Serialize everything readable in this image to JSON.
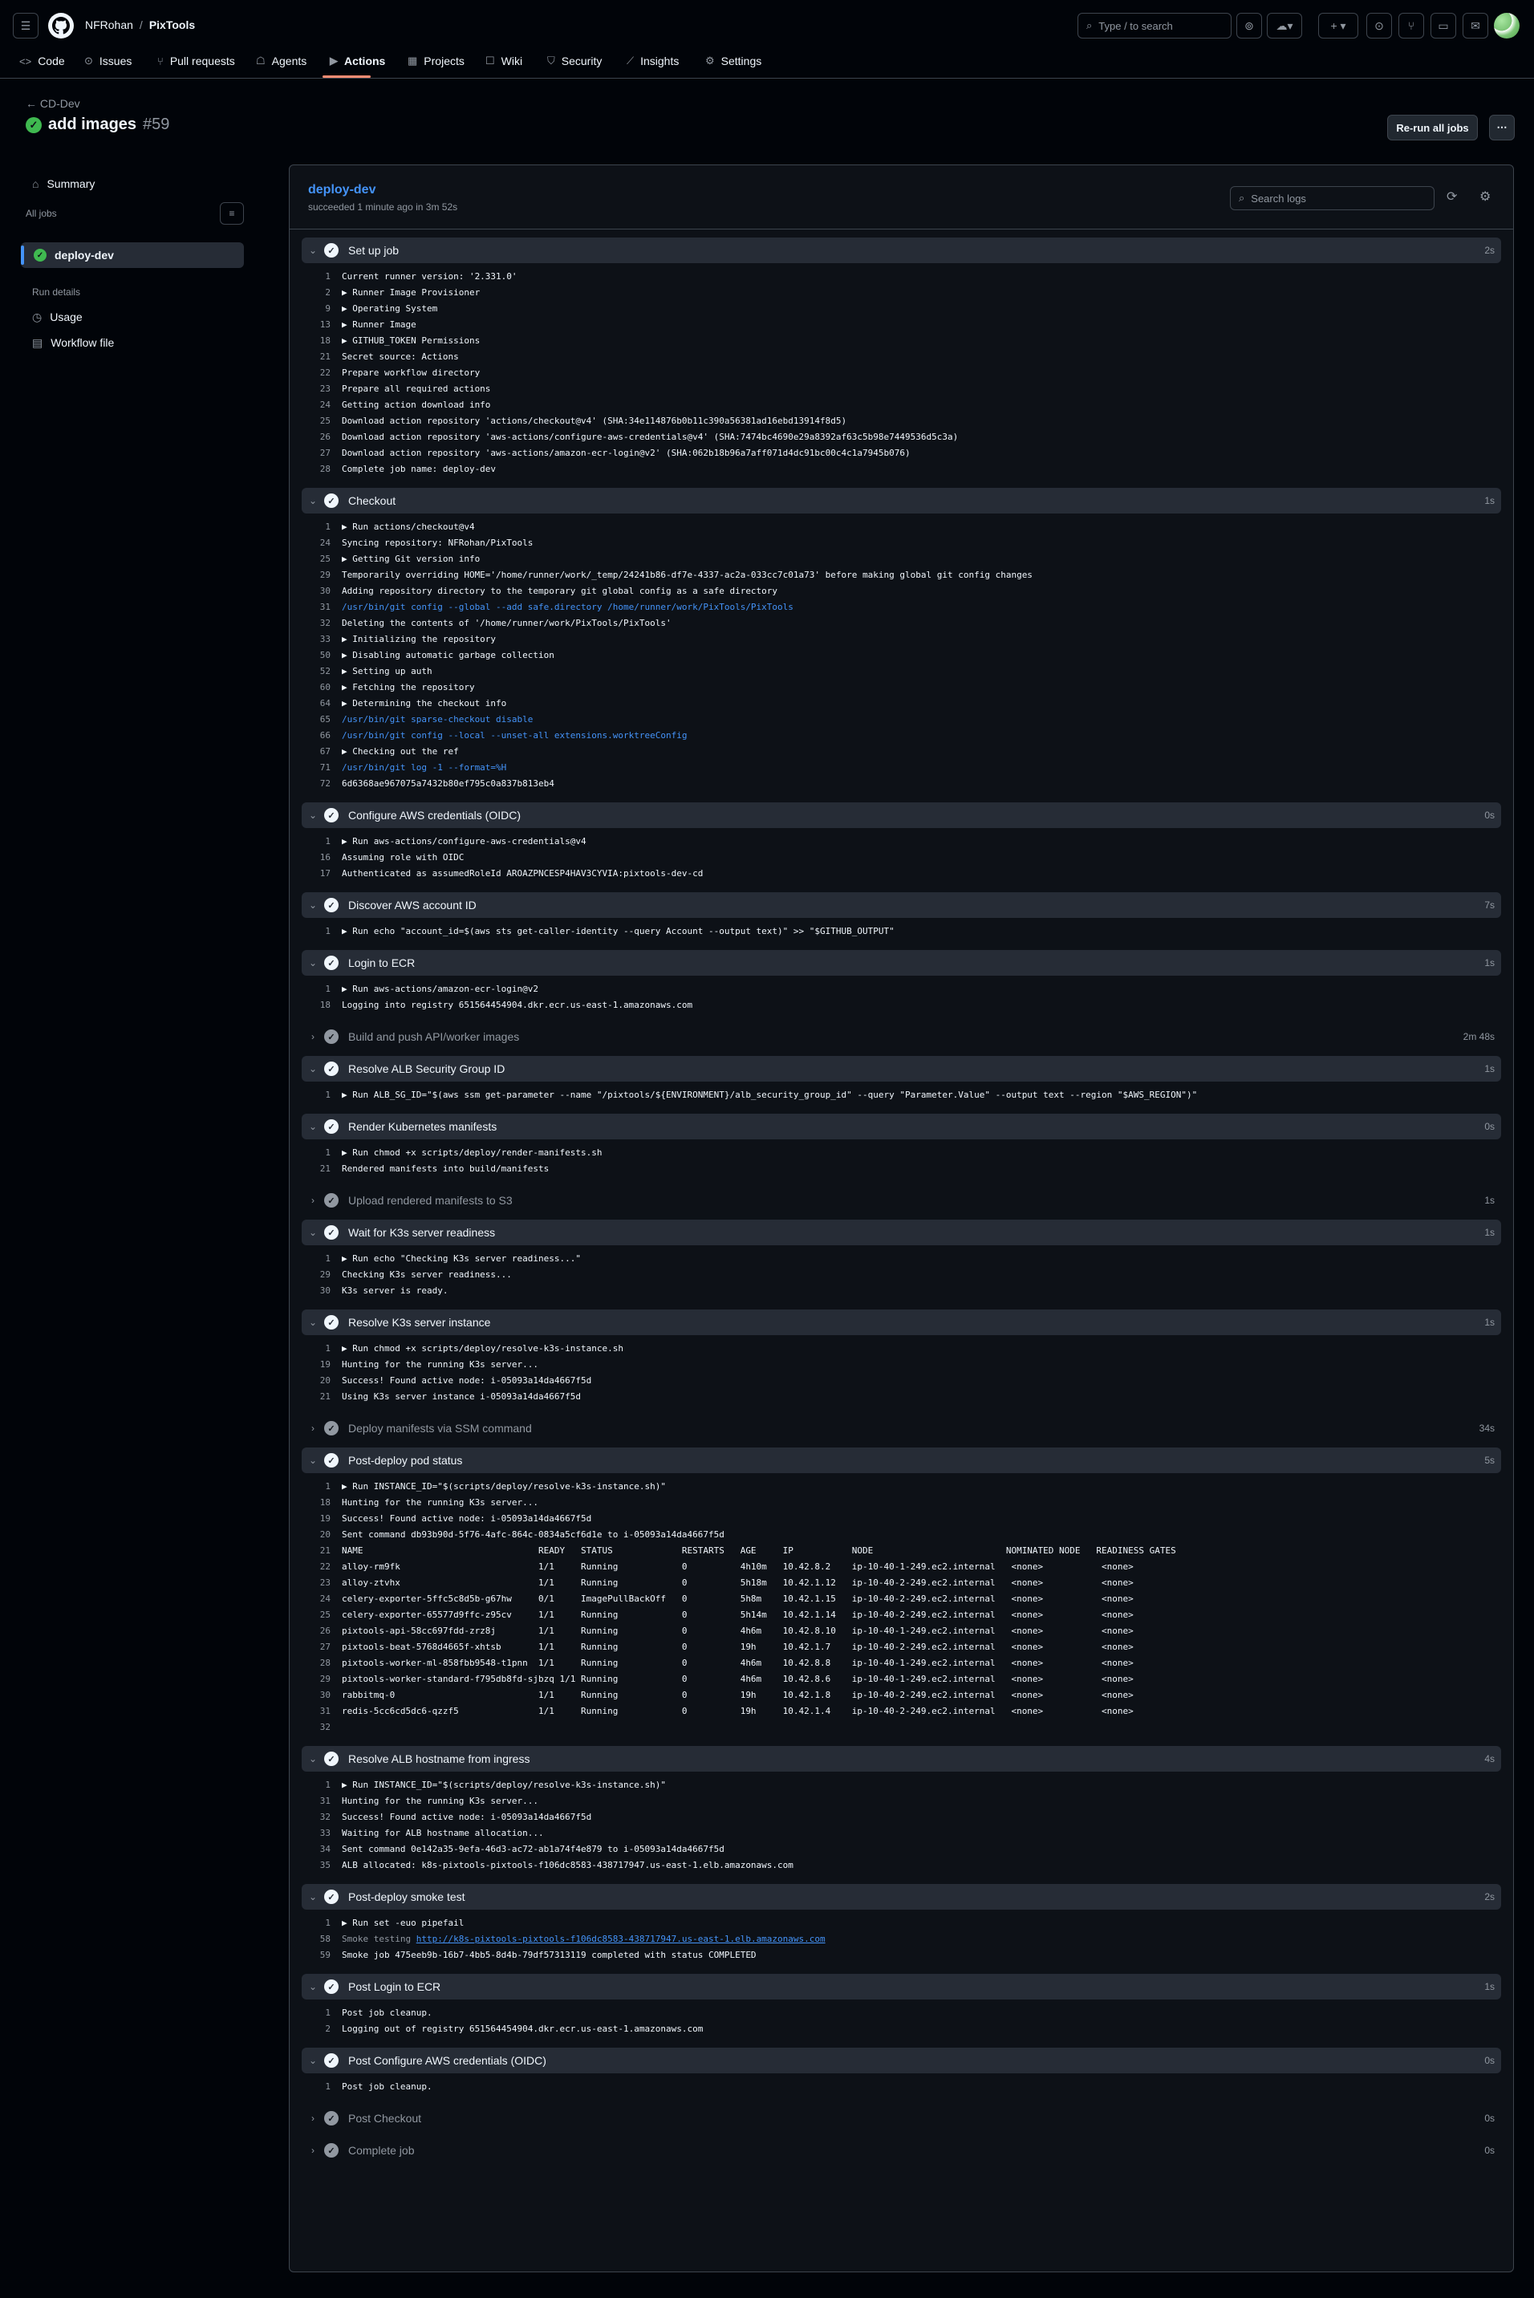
{
  "header": {
    "owner": "NFRohan",
    "separator": "/",
    "repo": "PixTools",
    "search_placeholder": "Type / to search",
    "nav": [
      {
        "label": "Code",
        "icon": "code-icon"
      },
      {
        "label": "Issues",
        "icon": "issue-icon"
      },
      {
        "label": "Pull requests",
        "icon": "pull-request-icon"
      },
      {
        "label": "Agents",
        "icon": "agents-icon"
      },
      {
        "label": "Actions",
        "icon": "actions-icon"
      },
      {
        "label": "Projects",
        "icon": "projects-icon"
      },
      {
        "label": "Wiki",
        "icon": "wiki-icon"
      },
      {
        "label": "Security",
        "icon": "shield-icon"
      },
      {
        "label": "Insights",
        "icon": "graph-icon"
      },
      {
        "label": "Settings",
        "icon": "gear-icon"
      }
    ]
  },
  "run": {
    "workflow": "CD-Dev",
    "title": "add images",
    "number": "#59",
    "rerun_label": "Re-run all jobs"
  },
  "sidebar": {
    "summary": "Summary",
    "all_jobs": "All jobs",
    "job": "deploy-dev",
    "run_details": "Run details",
    "usage": "Usage",
    "workflow_file": "Workflow file"
  },
  "job": {
    "name": "deploy-dev",
    "status": "succeeded 1 minute ago in 3m 52s",
    "search_placeholder": "Search logs"
  },
  "colors": {
    "accent": "#4493f8",
    "success": "#3fb950",
    "selected": "#fd8c73"
  },
  "steps": [
    {
      "name": "Set up job",
      "dur": "2s",
      "open": true,
      "lines": [
        {
          "n": "1",
          "t": "Current runner version: '2.331.0'"
        },
        {
          "n": "2",
          "t": "▶ Runner Image Provisioner"
        },
        {
          "n": "9",
          "t": "▶ Operating System"
        },
        {
          "n": "13",
          "t": "▶ Runner Image"
        },
        {
          "n": "18",
          "t": "▶ GITHUB_TOKEN Permissions"
        },
        {
          "n": "21",
          "t": "Secret source: Actions"
        },
        {
          "n": "22",
          "t": "Prepare workflow directory"
        },
        {
          "n": "23",
          "t": "Prepare all required actions"
        },
        {
          "n": "24",
          "t": "Getting action download info"
        },
        {
          "n": "25",
          "t": "Download action repository 'actions/checkout@v4' (SHA:34e114876b0b11c390a56381ad16ebd13914f8d5)"
        },
        {
          "n": "26",
          "t": "Download action repository 'aws-actions/configure-aws-credentials@v4' (SHA:7474bc4690e29a8392af63c5b98e7449536d5c3a)"
        },
        {
          "n": "27",
          "t": "Download action repository 'aws-actions/amazon-ecr-login@v2' (SHA:062b18b96a7aff071d4dc91bc00c4c1a7945b076)"
        },
        {
          "n": "28",
          "t": "Complete job name: deploy-dev"
        }
      ]
    },
    {
      "name": "Checkout",
      "dur": "1s",
      "open": true,
      "lines": [
        {
          "n": "1",
          "t": "▶ Run actions/checkout@v4"
        },
        {
          "n": "24",
          "t": "Syncing repository: NFRohan/PixTools"
        },
        {
          "n": "25",
          "t": "▶ Getting Git version info"
        },
        {
          "n": "29",
          "t": "Temporarily overriding HOME='/home/runner/work/_temp/24241b86-df7e-4337-ac2a-033cc7c01a73' before making global git config changes"
        },
        {
          "n": "30",
          "t": "Adding repository directory to the temporary git global config as a safe directory"
        },
        {
          "n": "31",
          "t": "/usr/bin/git config --global --add safe.directory /home/runner/work/PixTools/PixTools",
          "k": "cmd"
        },
        {
          "n": "32",
          "t": "Deleting the contents of '/home/runner/work/PixTools/PixTools'"
        },
        {
          "n": "33",
          "t": "▶ Initializing the repository"
        },
        {
          "n": "50",
          "t": "▶ Disabling automatic garbage collection"
        },
        {
          "n": "52",
          "t": "▶ Setting up auth"
        },
        {
          "n": "60",
          "t": "▶ Fetching the repository"
        },
        {
          "n": "64",
          "t": "▶ Determining the checkout info"
        },
        {
          "n": "65",
          "t": "/usr/bin/git sparse-checkout disable",
          "k": "cmd"
        },
        {
          "n": "66",
          "t": "/usr/bin/git config --local --unset-all extensions.worktreeConfig",
          "k": "cmd"
        },
        {
          "n": "67",
          "t": "▶ Checking out the ref"
        },
        {
          "n": "71",
          "t": "/usr/bin/git log -1 --format=%H",
          "k": "cmd"
        },
        {
          "n": "72",
          "t": "6d6368ae967075a7432b80ef795c0a837b813eb4"
        }
      ]
    },
    {
      "name": "Configure AWS credentials (OIDC)",
      "dur": "0s",
      "open": true,
      "lines": [
        {
          "n": "1",
          "t": "▶ Run aws-actions/configure-aws-credentials@v4"
        },
        {
          "n": "16",
          "t": "Assuming role with OIDC"
        },
        {
          "n": "17",
          "t": "Authenticated as assumedRoleId AROAZPNCESP4HAV3CYVIA:pixtools-dev-cd"
        }
      ]
    },
    {
      "name": "Discover AWS account ID",
      "dur": "7s",
      "open": true,
      "lines": [
        {
          "n": "1",
          "t": "▶ Run echo \"account_id=$(aws sts get-caller-identity --query Account --output text)\" >> \"$GITHUB_OUTPUT\""
        }
      ]
    },
    {
      "name": "Login to ECR",
      "dur": "1s",
      "open": true,
      "lines": [
        {
          "n": "1",
          "t": "▶ Run aws-actions/amazon-ecr-login@v2"
        },
        {
          "n": "18",
          "t": "Logging into registry 651564454904.dkr.ecr.us-east-1.amazonaws.com"
        }
      ]
    },
    {
      "name": "Build and push API/worker images",
      "dur": "2m 48s",
      "open": false,
      "lines": []
    },
    {
      "name": "Resolve ALB Security Group ID",
      "dur": "1s",
      "open": true,
      "lines": [
        {
          "n": "1",
          "t": "▶ Run ALB_SG_ID=\"$(aws ssm get-parameter --name \"/pixtools/${ENVIRONMENT}/alb_security_group_id\" --query \"Parameter.Value\" --output text --region \"$AWS_REGION\")\""
        }
      ]
    },
    {
      "name": "Render Kubernetes manifests",
      "dur": "0s",
      "open": true,
      "lines": [
        {
          "n": "1",
          "t": "▶ Run chmod +x scripts/deploy/render-manifests.sh"
        },
        {
          "n": "21",
          "t": "Rendered manifests into build/manifests"
        }
      ]
    },
    {
      "name": "Upload rendered manifests to S3",
      "dur": "1s",
      "open": false,
      "lines": []
    },
    {
      "name": "Wait for K3s server readiness",
      "dur": "1s",
      "open": true,
      "lines": [
        {
          "n": "1",
          "t": "▶ Run echo \"Checking K3s server readiness...\""
        },
        {
          "n": "29",
          "t": "Checking K3s server readiness..."
        },
        {
          "n": "30",
          "t": "K3s server is ready."
        }
      ]
    },
    {
      "name": "Resolve K3s server instance",
      "dur": "1s",
      "open": true,
      "lines": [
        {
          "n": "1",
          "t": "▶ Run chmod +x scripts/deploy/resolve-k3s-instance.sh"
        },
        {
          "n": "19",
          "t": "Hunting for the running K3s server..."
        },
        {
          "n": "20",
          "t": "Success! Found active node: i-05093a14da4667f5d"
        },
        {
          "n": "21",
          "t": "Using K3s server instance i-05093a14da4667f5d"
        }
      ]
    },
    {
      "name": "Deploy manifests via SSM command",
      "dur": "34s",
      "open": false,
      "lines": []
    },
    {
      "name": "Post-deploy pod status",
      "dur": "5s",
      "open": true,
      "lines": [
        {
          "n": "1",
          "t": "▶ Run INSTANCE_ID=\"$(scripts/deploy/resolve-k3s-instance.sh)\""
        },
        {
          "n": "18",
          "t": "Hunting for the running K3s server..."
        },
        {
          "n": "19",
          "t": "Success! Found active node: i-05093a14da4667f5d"
        },
        {
          "n": "20",
          "t": "Sent command db93b90d-5f76-4afc-864c-0834a5cf6d1e to i-05093a14da4667f5d"
        },
        {
          "n": "21",
          "t": "NAME                                 READY   STATUS             RESTARTS   AGE     IP           NODE                         NOMINATED NODE   READINESS GATES"
        },
        {
          "n": "22",
          "t": "alloy-rm9fk                          1/1     Running            0          4h10m   10.42.8.2    ip-10-40-1-249.ec2.internal   <none>           <none>"
        },
        {
          "n": "23",
          "t": "alloy-ztvhx                          1/1     Running            0          5h18m   10.42.1.12   ip-10-40-2-249.ec2.internal   <none>           <none>"
        },
        {
          "n": "24",
          "t": "celery-exporter-5ffc5c8d5b-g67hw     0/1     ImagePullBackOff   0          5h8m    10.42.1.15   ip-10-40-2-249.ec2.internal   <none>           <none>"
        },
        {
          "n": "25",
          "t": "celery-exporter-65577d9ffc-z95cv     1/1     Running            0          5h14m   10.42.1.14   ip-10-40-2-249.ec2.internal   <none>           <none>"
        },
        {
          "n": "26",
          "t": "pixtools-api-58cc697fdd-zrz8j        1/1     Running            0          4h6m    10.42.8.10   ip-10-40-1-249.ec2.internal   <none>           <none>"
        },
        {
          "n": "27",
          "t": "pixtools-beat-5768d4665f-xhtsb       1/1     Running            0          19h     10.42.1.7    ip-10-40-2-249.ec2.internal   <none>           <none>"
        },
        {
          "n": "28",
          "t": "pixtools-worker-ml-858fbb9548-t1pnn  1/1     Running            0          4h6m    10.42.8.8    ip-10-40-1-249.ec2.internal   <none>           <none>"
        },
        {
          "n": "29",
          "t": "pixtools-worker-standard-f795db8fd-sjbzq 1/1 Running            0          4h6m    10.42.8.6    ip-10-40-1-249.ec2.internal   <none>           <none>"
        },
        {
          "n": "30",
          "t": "rabbitmq-0                           1/1     Running            0          19h     10.42.1.8    ip-10-40-2-249.ec2.internal   <none>           <none>"
        },
        {
          "n": "31",
          "t": "redis-5cc6cd5dc6-qzzf5               1/1     Running            0          19h     10.42.1.4    ip-10-40-2-249.ec2.internal   <none>           <none>"
        },
        {
          "n": "32",
          "t": ""
        }
      ]
    },
    {
      "name": "Resolve ALB hostname from ingress",
      "dur": "4s",
      "open": true,
      "lines": [
        {
          "n": "1",
          "t": "▶ Run INSTANCE_ID=\"$(scripts/deploy/resolve-k3s-instance.sh)\""
        },
        {
          "n": "31",
          "t": "Hunting for the running K3s server..."
        },
        {
          "n": "32",
          "t": "Success! Found active node: i-05093a14da4667f5d"
        },
        {
          "n": "33",
          "t": "Waiting for ALB hostname allocation..."
        },
        {
          "n": "34",
          "t": "Sent command 0e142a35-9efa-46d3-ac72-ab1a74f4e879 to i-05093a14da4667f5d"
        },
        {
          "n": "35",
          "t": "ALB allocated: k8s-pixtools-pixtools-f106dc8583-438717947.us-east-1.elb.amazonaws.com"
        }
      ]
    },
    {
      "name": "Post-deploy smoke test",
      "dur": "2s",
      "open": true,
      "lines": [
        {
          "n": "1",
          "t": "▶ Run set -euo pipefail"
        },
        {
          "n": "58",
          "t": "Smoke testing ",
          "u": "http://k8s-pixtools-pixtools-f106dc8583-438717947.us-east-1.elb.amazonaws.com",
          "k": "lnk"
        },
        {
          "n": "59",
          "t": "Smoke job 475eeb9b-16b7-4bb5-8d4b-79df57313119 completed with status COMPLETED"
        }
      ]
    },
    {
      "name": "Post Login to ECR",
      "dur": "1s",
      "open": true,
      "lines": [
        {
          "n": "1",
          "t": "Post job cleanup."
        },
        {
          "n": "2",
          "t": "Logging out of registry 651564454904.dkr.ecr.us-east-1.amazonaws.com"
        }
      ]
    },
    {
      "name": "Post Configure AWS credentials (OIDC)",
      "dur": "0s",
      "open": true,
      "lines": [
        {
          "n": "1",
          "t": "Post job cleanup."
        }
      ]
    },
    {
      "name": "Post Checkout",
      "dur": "0s",
      "open": false,
      "lines": []
    },
    {
      "name": "Complete job",
      "dur": "0s",
      "open": false,
      "lines": []
    }
  ]
}
